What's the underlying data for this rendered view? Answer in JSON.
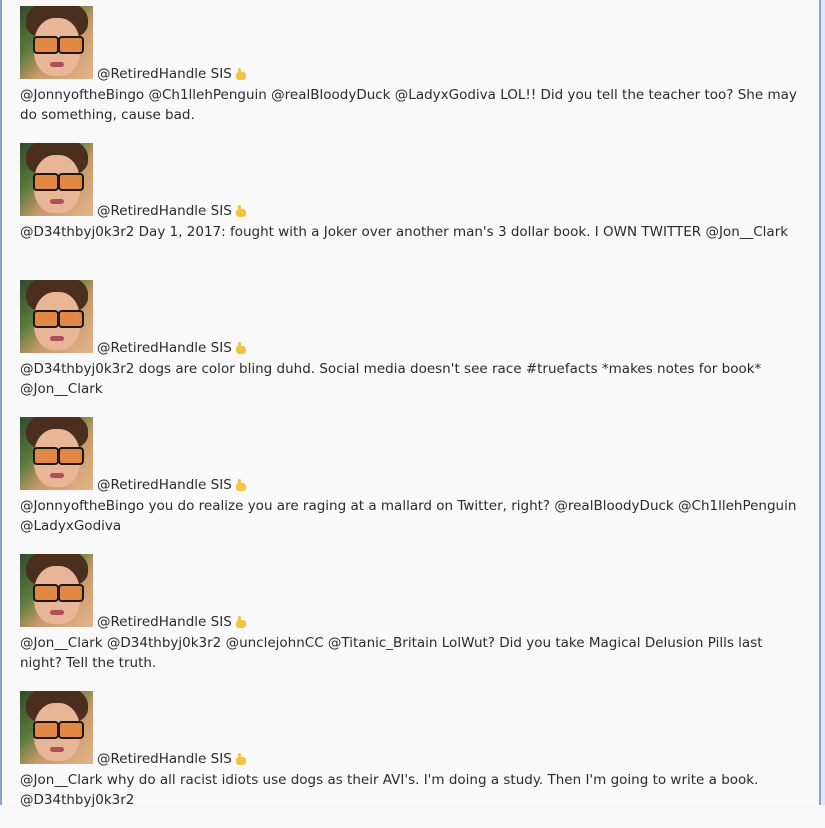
{
  "tweets": [
    {
      "handle": "@RetiredHandle SIS",
      "text": "@JonnyoftheBingo @Ch1llehPenguin @realBloodyDuck @LadyxGodiva LOL!! Did you tell the teacher too? She may do something, cause bad."
    },
    {
      "handle": "@RetiredHandle SIS",
      "text": "@D34thbyj0k3r2 Day 1, 2017: fought with a Joker over another man's 3 dollar book. I OWN TWITTER @Jon__Clark"
    },
    {
      "handle": "@RetiredHandle SIS",
      "text": "@D34thbyj0k3r2 dogs are color bling duhd. Social media doesn't see race #truefacts *makes notes for book* @Jon__Clark"
    },
    {
      "handle": "@RetiredHandle SIS",
      "text": "@JonnyoftheBingo you do realize you are raging at a mallard on Twitter, right? @realBloodyDuck @Ch1llehPenguin @LadyxGodiva"
    },
    {
      "handle": "@RetiredHandle SIS",
      "text": "@Jon__Clark @D34thbyj0k3r2 @unclejohnCC @Titanic_Britain LolWut? Did you take Magical Delusion Pills last night? Tell the truth."
    },
    {
      "handle": "@RetiredHandle SIS",
      "text": "@Jon__Clark why do all racist idiots use dogs as their AVI's. I'm doing a study. Then I'm going to write a book. @D34thbyj0k3r2"
    }
  ]
}
